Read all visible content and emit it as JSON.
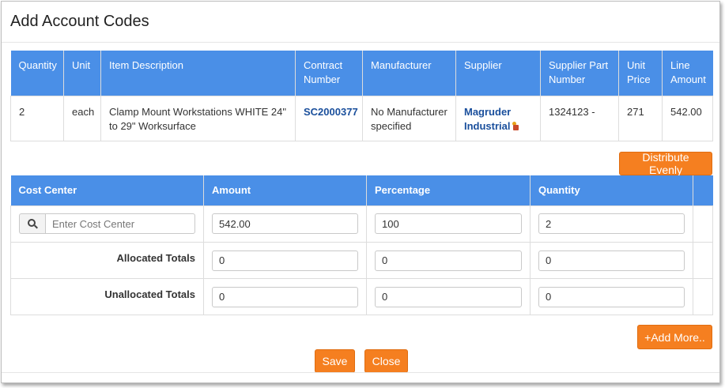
{
  "modal": {
    "title": "Add Account Codes"
  },
  "items_table": {
    "headers": [
      "Quantity",
      "Unit",
      "Item Description",
      "Contract Number",
      "Manufacturer",
      "Supplier",
      "Supplier Part Number",
      "Unit Price",
      "Line Amount"
    ],
    "row": {
      "quantity": "2",
      "unit": "each",
      "description": "Clamp Mount Workstations WHITE 24\" to 29\" Worksurface",
      "contract_number": "SC2000377",
      "manufacturer": "No Manufacturer specified",
      "supplier": "Magruder Industrial",
      "supplier_part_number": "1324123 -",
      "unit_price": "271",
      "line_amount": "542.00"
    }
  },
  "distribute_button": "Distribute Evenly",
  "cost_table": {
    "headers": [
      "Cost Center",
      "Amount",
      "Percentage",
      "Quantity"
    ],
    "search_placeholder": "Enter Cost Center",
    "entry": {
      "amount": "542.00",
      "percentage": "100",
      "quantity": "2"
    },
    "allocated": {
      "label": "Allocated Totals",
      "amount": "0",
      "percentage": "0",
      "quantity": "0"
    },
    "unallocated": {
      "label": "Unallocated Totals",
      "amount": "0",
      "percentage": "0",
      "quantity": "0"
    }
  },
  "add_more_button": "+Add More..",
  "save_button": "Save",
  "close_button": "Close",
  "colors": {
    "header_blue": "#4a8fe7",
    "accent_orange": "#f57f20",
    "link_blue": "#1a4f9c"
  }
}
